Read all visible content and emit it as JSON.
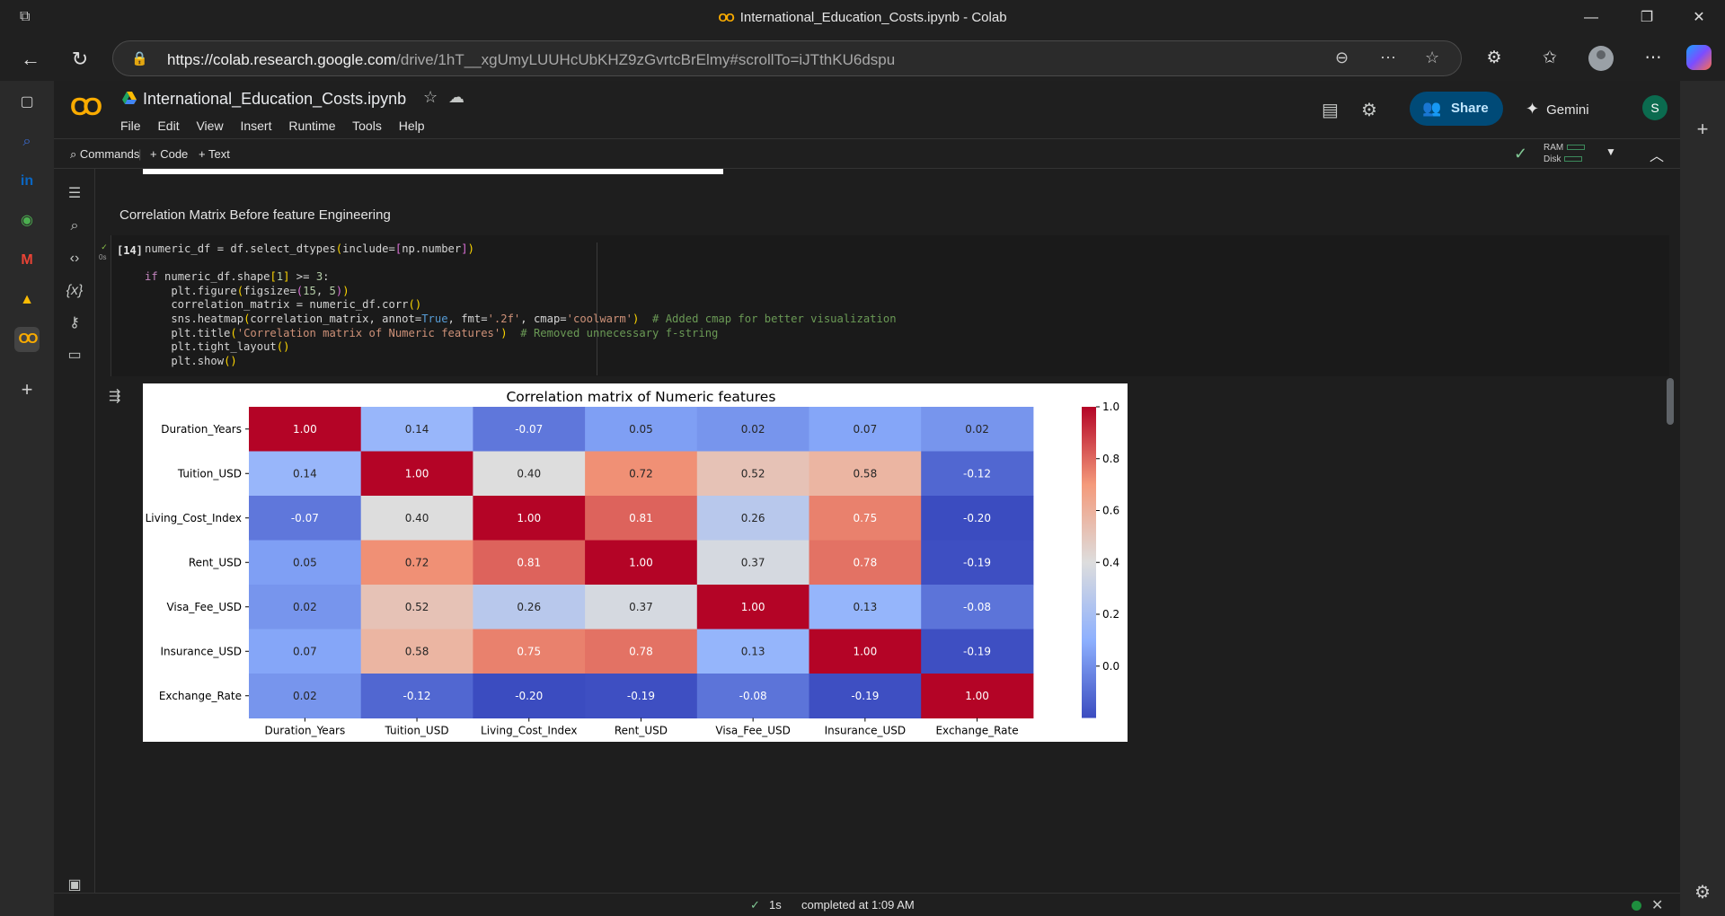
{
  "browser": {
    "window_title": "International_Education_Costs.ipynb - Colab",
    "url_domain": "https://colab.research.google.com",
    "url_path": "/drive/1hT__xgUmyLUUHcUbKHZ9zGvrtcBrElmy#scrollTo=iJTthKU6dspu",
    "brand_color": "#f9ab00"
  },
  "colab": {
    "logo_text": "CO",
    "notebook_title": "International_Education_Costs.ipynb",
    "menu": [
      "File",
      "Edit",
      "View",
      "Insert",
      "Runtime",
      "Tools",
      "Help"
    ],
    "share_label": "Share",
    "gemini_label": "Gemini",
    "avatar_initial": "S",
    "toolbar": {
      "commands": "Commands",
      "add_code": "+ Code",
      "add_text": "+ Text",
      "ram": "RAM",
      "disk": "Disk"
    },
    "accent_color": "#004a77"
  },
  "notebook": {
    "markdown_heading": "Correlation Matrix Before feature Engineering",
    "cell": {
      "exec_count": "[14]",
      "run_status": "✓",
      "run_time": "0s"
    }
  },
  "status_bar": {
    "check": "✓",
    "duration": "1s",
    "message": "completed at 1:09 AM"
  },
  "chart_data": {
    "type": "heatmap",
    "title": "Correlation matrix of Numeric features",
    "colormap": "coolwarm",
    "rows": [
      "Duration_Years",
      "Tuition_USD",
      "Living_Cost_Index",
      "Rent_USD",
      "Visa_Fee_USD",
      "Insurance_USD",
      "Exchange_Rate"
    ],
    "columns": [
      "Duration_Years",
      "Tuition_USD",
      "Living_Cost_Index",
      "Rent_USD",
      "Visa_Fee_USD",
      "Insurance_USD",
      "Exchange_Rate"
    ],
    "values": [
      [
        1.0,
        0.14,
        -0.07,
        0.05,
        0.02,
        0.07,
        0.02
      ],
      [
        0.14,
        1.0,
        0.4,
        0.72,
        0.52,
        0.58,
        -0.12
      ],
      [
        -0.07,
        0.4,
        1.0,
        0.81,
        0.26,
        0.75,
        -0.2
      ],
      [
        0.05,
        0.72,
        0.81,
        1.0,
        0.37,
        0.78,
        -0.19
      ],
      [
        0.02,
        0.52,
        0.26,
        0.37,
        1.0,
        0.13,
        -0.08
      ],
      [
        0.07,
        0.58,
        0.75,
        0.78,
        0.13,
        1.0,
        -0.19
      ],
      [
        0.02,
        -0.12,
        -0.2,
        -0.19,
        -0.08,
        -0.19,
        1.0
      ]
    ],
    "vmin": -0.2,
    "vmax": 1.0,
    "colorbar_ticks": [
      1.0,
      0.8,
      0.6,
      0.4,
      0.2,
      0.0
    ],
    "annotation_format": ".2f"
  }
}
